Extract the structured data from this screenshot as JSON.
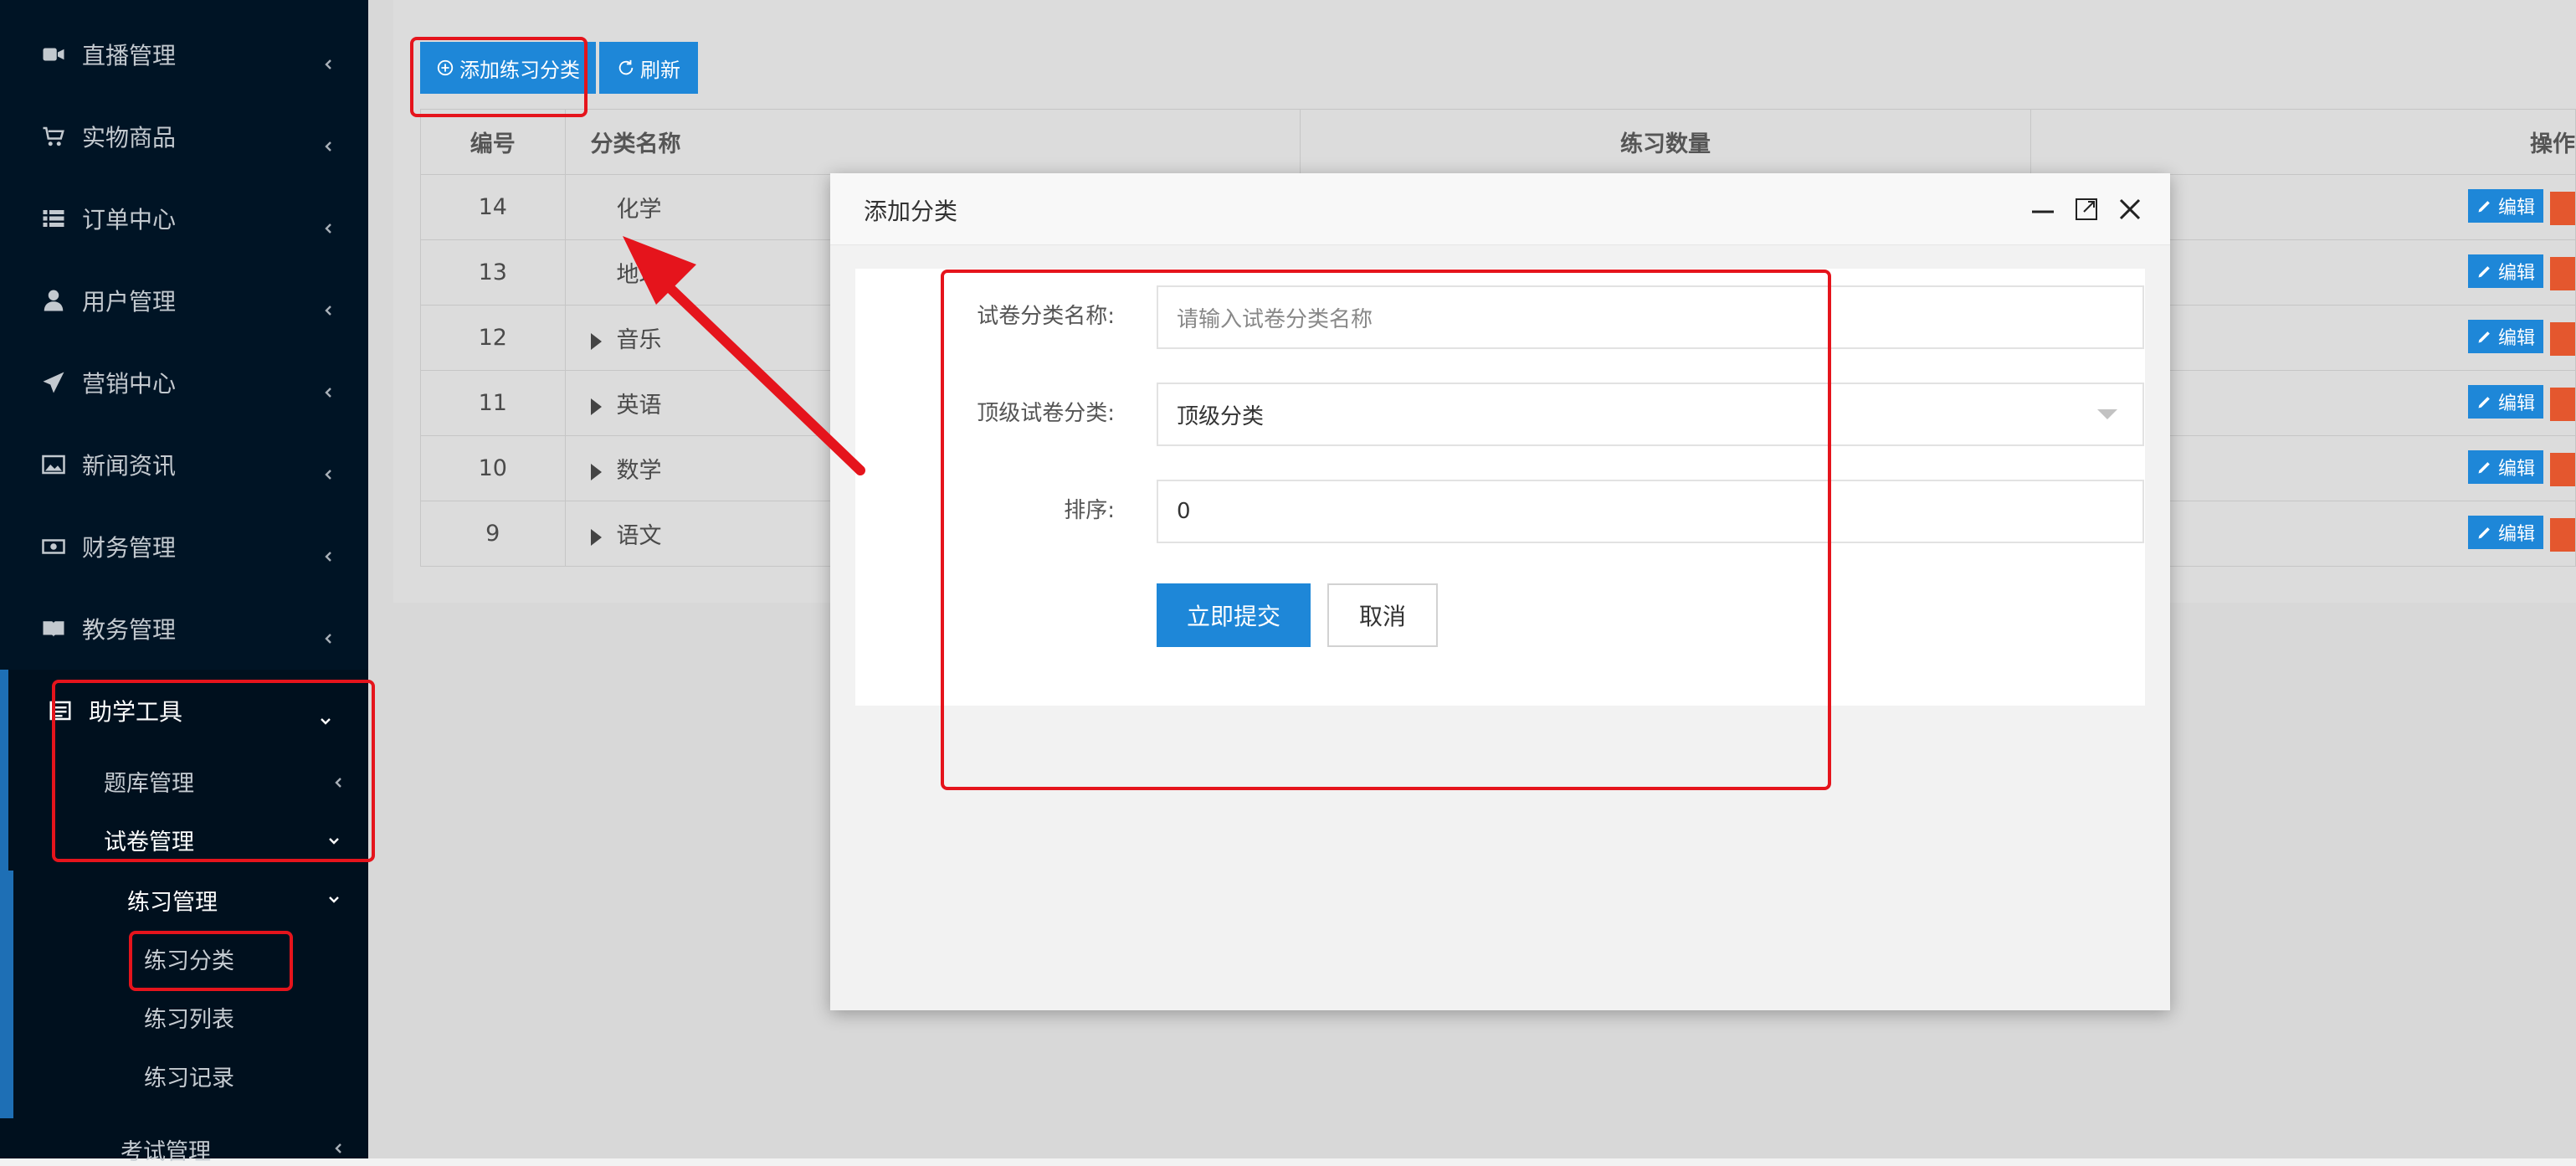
{
  "sidebar": {
    "items": [
      {
        "label": "直播管理",
        "icon": "video-icon"
      },
      {
        "label": "实物商品",
        "icon": "cart-icon"
      },
      {
        "label": "订单中心",
        "icon": "list-icon"
      },
      {
        "label": "用户管理",
        "icon": "user-icon"
      },
      {
        "label": "营销中心",
        "icon": "paper-plane-icon"
      },
      {
        "label": "新闻资讯",
        "icon": "image-icon"
      },
      {
        "label": "财务管理",
        "icon": "money-icon"
      },
      {
        "label": "教务管理",
        "icon": "book-icon"
      }
    ],
    "helper_tools": "助学工具",
    "question_bank": "题库管理",
    "paper_manage": "试卷管理",
    "practice_manage": "练习管理",
    "practice_category": "练习分类",
    "practice_list": "练习列表",
    "practice_record": "练习记录",
    "exam_manage": "考试管理"
  },
  "toolbar": {
    "add_label": "添加练习分类",
    "refresh_label": "刷新"
  },
  "table": {
    "headers": {
      "id": "编号",
      "name": "分类名称",
      "count": "练习数量",
      "op": "操作"
    },
    "rows": [
      {
        "id": "14",
        "name": "化学",
        "expandable": false
      },
      {
        "id": "13",
        "name": "地理",
        "expandable": false
      },
      {
        "id": "12",
        "name": "音乐",
        "expandable": true
      },
      {
        "id": "11",
        "name": "英语",
        "expandable": true
      },
      {
        "id": "10",
        "name": "数学",
        "expandable": true
      },
      {
        "id": "9",
        "name": "语文",
        "expandable": true
      }
    ],
    "edit_label": "编辑"
  },
  "modal": {
    "title": "添加分类",
    "fields": {
      "name_label": "试卷分类名称:",
      "name_placeholder": "请输入试卷分类名称",
      "parent_label": "顶级试卷分类:",
      "parent_value": "顶级分类",
      "sort_label": "排序:",
      "sort_value": "0"
    },
    "submit_label": "立即提交",
    "cancel_label": "取消"
  },
  "colors": {
    "sidebar_bg": "#001425",
    "primary": "#1e87d8",
    "danger": "#e4572e",
    "annotation": "#e5141c"
  }
}
